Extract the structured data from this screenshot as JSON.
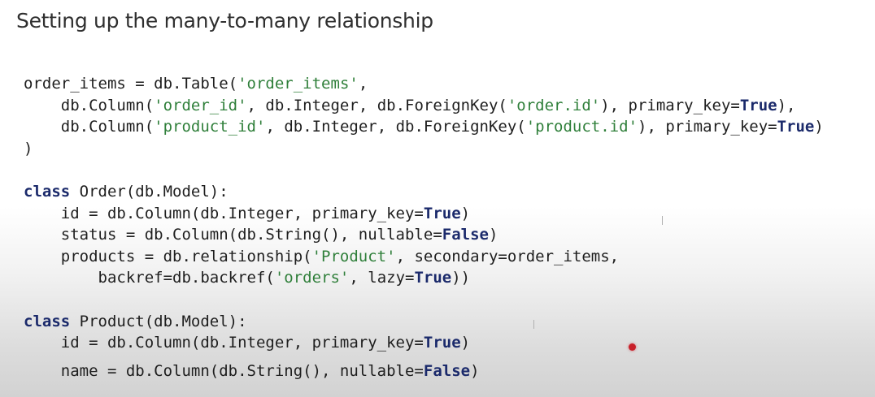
{
  "slide": {
    "title": "Setting up the many-to-many relationship"
  },
  "code": {
    "lines": [
      [
        {
          "t": "order_items = db.Table("
        },
        {
          "t": "'order_items'",
          "s": "str"
        },
        {
          "t": ","
        }
      ],
      [
        {
          "t": "    db.Column("
        },
        {
          "t": "'order_id'",
          "s": "str"
        },
        {
          "t": ", db.Integer, db.ForeignKey("
        },
        {
          "t": "'order.id'",
          "s": "str"
        },
        {
          "t": "), primary_key="
        },
        {
          "t": "True",
          "s": "kw"
        },
        {
          "t": "),"
        }
      ],
      [
        {
          "t": "    db.Column("
        },
        {
          "t": "'product_id'",
          "s": "str"
        },
        {
          "t": ", db.Integer, db.ForeignKey("
        },
        {
          "t": "'product.id'",
          "s": "str"
        },
        {
          "t": "), primary_key="
        },
        {
          "t": "True",
          "s": "kw"
        },
        {
          "t": ")"
        }
      ],
      [
        {
          "t": ")"
        }
      ],
      [
        {
          "t": "class",
          "s": "kw"
        },
        {
          "t": " Order(db.Model):"
        }
      ],
      [
        {
          "t": "    id = db.Column(db.Integer, primary_key="
        },
        {
          "t": "True",
          "s": "kw"
        },
        {
          "t": ")"
        }
      ],
      [
        {
          "t": "    status = db.Column(db.String(), nullable="
        },
        {
          "t": "False",
          "s": "kw"
        },
        {
          "t": ")"
        }
      ],
      [
        {
          "t": "    products = db.relationship("
        },
        {
          "t": "'Product'",
          "s": "str"
        },
        {
          "t": ", secondary=order_items,"
        }
      ],
      [
        {
          "t": "        backref=db.backref("
        },
        {
          "t": "'orders'",
          "s": "str"
        },
        {
          "t": ", lazy="
        },
        {
          "t": "True",
          "s": "kw"
        },
        {
          "t": "))"
        }
      ],
      [
        {
          "t": "class",
          "s": "kw"
        },
        {
          "t": " Product(db.Model):"
        }
      ],
      [
        {
          "t": "    id = db.Column(db.Integer, primary_key="
        },
        {
          "t": "True",
          "s": "kw"
        },
        {
          "t": ")"
        }
      ],
      [
        {
          "t": "    name = db.Column(db.String(), nullable="
        },
        {
          "t": "False",
          "s": "kw"
        },
        {
          "t": ")"
        }
      ]
    ]
  },
  "colors": {
    "keyword": "#1b2a6b",
    "string": "#2f7f3a",
    "text": "#1e1e1e",
    "laser_pointer": "#c8202a"
  }
}
